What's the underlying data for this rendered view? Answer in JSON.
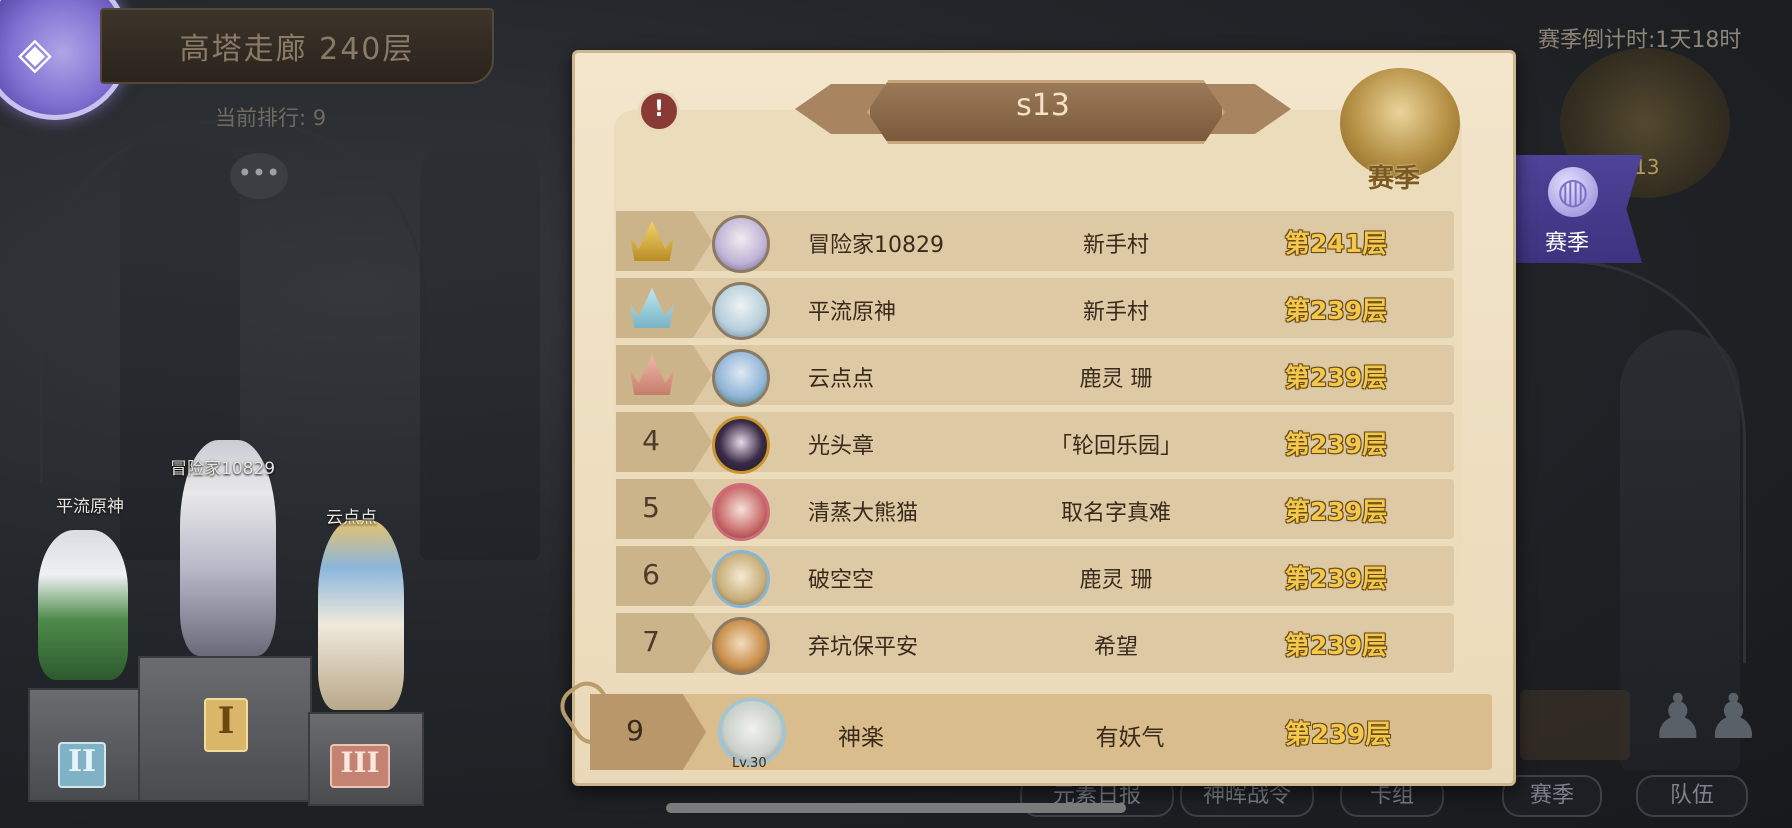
{
  "header": {
    "title": "高塔走廊 240层",
    "current_rank": "当前排行: 9"
  },
  "top_right": {
    "countdown": "赛季倒计时:1天18时",
    "emblem_number": "13",
    "season_tab_label": "赛季"
  },
  "panel": {
    "season_name": "s13",
    "season_badge_label": "赛季",
    "rows": [
      {
        "rank": "1",
        "crown": "gold",
        "name": "冒险家10829",
        "guild": "新手村",
        "floor": "第241层"
      },
      {
        "rank": "2",
        "crown": "silver",
        "name": "平流原神",
        "guild": "新手村",
        "floor": "第239层"
      },
      {
        "rank": "3",
        "crown": "bronze",
        "name": "云点点",
        "guild": "鹿灵  珊",
        "floor": "第239层"
      },
      {
        "rank": "4",
        "name": "光头章",
        "guild": "「轮回乐园」",
        "floor": "第239层"
      },
      {
        "rank": "5",
        "name": "清蒸大熊猫",
        "guild": "取名字真难",
        "floor": "第239层"
      },
      {
        "rank": "6",
        "name": "破空空",
        "guild": "鹿灵  珊",
        "floor": "第239层"
      },
      {
        "rank": "7",
        "name": "弃坑保平安",
        "guild": "希望",
        "floor": "第239层"
      }
    ],
    "self": {
      "rank": "9",
      "level": "Lv.30",
      "name": "神楽",
      "guild": "有妖气",
      "floor": "第239层"
    }
  },
  "podium": {
    "first": {
      "name": "冒险家10829",
      "numeral": "I"
    },
    "second": {
      "name": "平流原神",
      "numeral": "II"
    },
    "third": {
      "name": "云点点",
      "numeral": "III"
    }
  },
  "bottom_nav": [
    "元素日报",
    "神晖战令",
    "卡组",
    "赛季",
    "队伍"
  ],
  "colors": {
    "panel_bg": "#f3e6cc",
    "row_bg": "#ddc9a4",
    "floor_text": "#f2c94c",
    "season_flag": "#4d4398"
  }
}
